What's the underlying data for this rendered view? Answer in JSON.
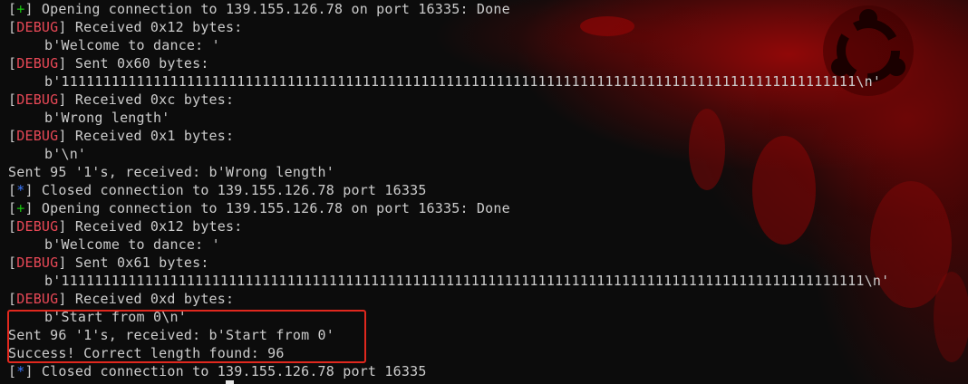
{
  "colors": {
    "background": "#0c0c0c",
    "text": "#cccccc",
    "plus_marker": "#16c60c",
    "star_marker": "#3b78ff",
    "debug_label": "#e74856",
    "highlight_border": "#e0281e",
    "wallpaper_red": "#8a0606"
  },
  "wallpaper": {
    "logo_icon": "ubuntu-logo-icon"
  },
  "terminal": {
    "lines": [
      {
        "marker": "+",
        "text": " Opening connection to 139.155.126.78 on port 16335: Done"
      },
      {
        "marker": "DEBUG",
        "text": " Received 0x12 bytes:"
      },
      {
        "indent": true,
        "text": "b'Welcome to dance: '"
      },
      {
        "marker": "DEBUG",
        "text": " Sent 0x60 bytes:"
      },
      {
        "indent": true,
        "text": "b'11111111111111111111111111111111111111111111111111111111111111111111111111111111111111111111111\\n'"
      },
      {
        "marker": "DEBUG",
        "text": " Received 0xc bytes:"
      },
      {
        "indent": true,
        "text": "b'Wrong length'"
      },
      {
        "marker": "DEBUG",
        "text": " Received 0x1 bytes:"
      },
      {
        "indent": true,
        "text": "b'\\n'"
      },
      {
        "text": "Sent 95 '1's, received: b'Wrong length'"
      },
      {
        "marker": "*",
        "text": " Closed connection to 139.155.126.78 port 16335"
      },
      {
        "marker": "+",
        "text": " Opening connection to 139.155.126.78 on port 16335: Done"
      },
      {
        "marker": "DEBUG",
        "text": " Received 0x12 bytes:"
      },
      {
        "indent": true,
        "text": "b'Welcome to dance: '"
      },
      {
        "marker": "DEBUG",
        "text": " Sent 0x61 bytes:"
      },
      {
        "indent": true,
        "text": "b'111111111111111111111111111111111111111111111111111111111111111111111111111111111111111111111111\\n'"
      },
      {
        "marker": "DEBUG",
        "text": " Received 0xd bytes:"
      },
      {
        "indent": true,
        "text": "b'Start from 0\\n'"
      },
      {
        "text": "Sent 96 '1's, received: b'Start from 0'"
      },
      {
        "text": "Success! Correct length found: 96"
      },
      {
        "marker": "*",
        "text": " Closed connection to 139.155.126.78 port 16335"
      }
    ]
  }
}
